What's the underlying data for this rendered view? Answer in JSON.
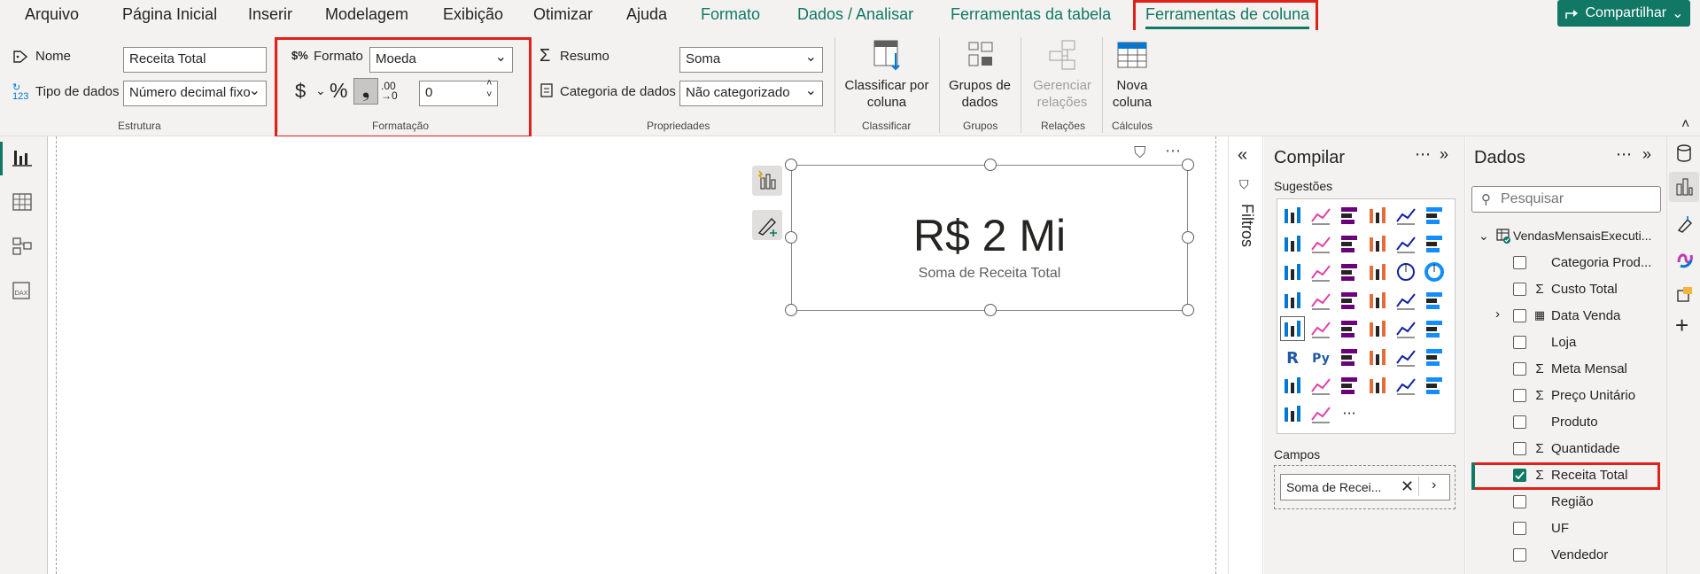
{
  "tabs": [
    {
      "label": "Arquivo"
    },
    {
      "label": "Página Inicial"
    },
    {
      "label": "Inserir"
    },
    {
      "label": "Modelagem"
    },
    {
      "label": "Exibição"
    },
    {
      "label": "Otimizar"
    },
    {
      "label": "Ajuda"
    },
    {
      "label": "Formato"
    },
    {
      "label": "Dados / Analisar"
    },
    {
      "label": "Ferramentas da tabela"
    },
    {
      "label": "Ferramentas de coluna"
    }
  ],
  "share_label": "Compartilhar",
  "structure": {
    "name_label": "Nome",
    "name_value": "Receita Total",
    "datatype_label": "Tipo de dados",
    "datatype_value": "Número decimal fixo",
    "group": "Estrutura"
  },
  "formatting": {
    "format_label": "Formato",
    "format_value": "Moeda",
    "decimals_value": "0",
    "group": "Formatação"
  },
  "properties": {
    "summary_label": "Resumo",
    "summary_value": "Soma",
    "category_label": "Categoria de dados",
    "category_value": "Não categorizado",
    "group": "Propriedades"
  },
  "sort": {
    "line1": "Classificar por",
    "line2": "coluna",
    "group": "Classificar"
  },
  "groups": {
    "line1": "Grupos de",
    "line2": "dados",
    "group": "Grupos"
  },
  "relations": {
    "line1": "Gerenciar",
    "line2": "relações",
    "group": "Relações"
  },
  "calc": {
    "line1": "Nova",
    "line2": "coluna",
    "group": "Cálculos"
  },
  "card": {
    "value": "R$ 2 Mi",
    "label": "Soma de Receita Total"
  },
  "filters_label": "Filtros",
  "build": {
    "title": "Compilar",
    "suggestions": "Sugestões",
    "fields_label": "Campos",
    "field_chip": "Soma de Recei..."
  },
  "data": {
    "title": "Dados",
    "search_placeholder": "Pesquisar",
    "table_name": "VendasMensaisExecuti...",
    "fields": [
      {
        "name": "Categoria Prod...",
        "sigma": false,
        "checked": false,
        "expand": false,
        "calendar": false
      },
      {
        "name": "Custo Total",
        "sigma": true,
        "checked": false,
        "expand": false,
        "calendar": false
      },
      {
        "name": "Data Venda",
        "sigma": false,
        "checked": false,
        "expand": true,
        "calendar": true
      },
      {
        "name": "Loja",
        "sigma": false,
        "checked": false,
        "expand": false,
        "calendar": false
      },
      {
        "name": "Meta Mensal",
        "sigma": true,
        "checked": false,
        "expand": false,
        "calendar": false
      },
      {
        "name": "Preço Unitário",
        "sigma": true,
        "checked": false,
        "expand": false,
        "calendar": false
      },
      {
        "name": "Produto",
        "sigma": false,
        "checked": false,
        "expand": false,
        "calendar": false
      },
      {
        "name": "Quantidade",
        "sigma": true,
        "checked": false,
        "expand": false,
        "calendar": false
      },
      {
        "name": "Receita Total",
        "sigma": true,
        "checked": true,
        "expand": false,
        "calendar": false
      },
      {
        "name": "Região",
        "sigma": false,
        "checked": false,
        "expand": false,
        "calendar": false
      },
      {
        "name": "UF",
        "sigma": false,
        "checked": false,
        "expand": false,
        "calendar": false
      },
      {
        "name": "Vendedor",
        "sigma": false,
        "checked": false,
        "expand": false,
        "calendar": false
      }
    ]
  },
  "colors": {
    "accent": "#117865",
    "highlight": "#e0201b"
  }
}
